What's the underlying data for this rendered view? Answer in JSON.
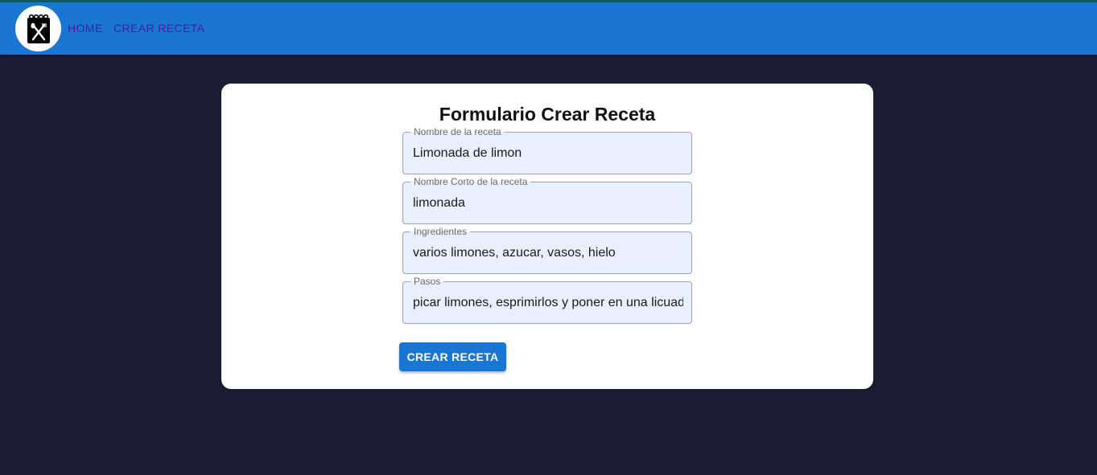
{
  "nav": {
    "logo_icon": "recipe-notebook-icon",
    "home_label": "HOME",
    "crear_label": "CREAR RECETA"
  },
  "form": {
    "title": "Formulario Crear Receta",
    "fields": [
      {
        "label": "Nombre de la receta",
        "value": "Limonada de limon"
      },
      {
        "label": "Nombre Corto de la receta",
        "value": "limonada"
      },
      {
        "label": "Ingredientes",
        "value": "varios limones, azucar, vasos, hielo"
      },
      {
        "label": "Pasos",
        "value": "picar limones, esprimirlos y poner en una licuadora"
      }
    ],
    "submit_label": "CREAR RECETA"
  },
  "colors": {
    "appbar": "#1976d2",
    "nav_link": "#4a1aa8",
    "background": "#1a1c33",
    "field_bg": "#e8f0fe"
  }
}
